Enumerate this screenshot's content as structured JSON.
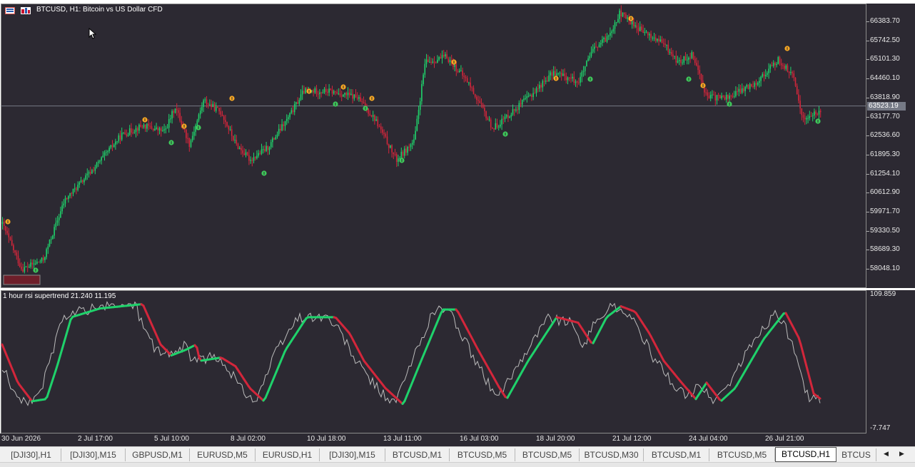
{
  "chart": {
    "title": "BTCUSD, H1:  Bitcoin vs US Dollar CFD",
    "current_price": "63523.19",
    "price_labels": [
      "66383.70",
      "65742.50",
      "65101.30",
      "64460.10",
      "63818.90",
      "63177.70",
      "62536.60",
      "61895.30",
      "61254.10",
      "60612.90",
      "59971.70",
      "59330.50",
      "58689.30",
      "58048.10"
    ],
    "time_labels": [
      "30 Jun 2026",
      "2 Jul 17:00",
      "5 Jul 10:00",
      "8 Jul 02:00",
      "10 Jul 18:00",
      "13 Jul 11:00",
      "16 Jul 03:00",
      "18 Jul 20:00",
      "21 Jul 12:00",
      "24 Jul 04:00",
      "26 Jul 21:00"
    ],
    "price_range": [
      57700,
      66800
    ],
    "price_line": 63523.19,
    "bull_color": "#1fd26b",
    "bear_color": "#d3263b",
    "sell_marker_color": "#f5a623",
    "buy_marker_color": "#3ec95a"
  },
  "indicator": {
    "title": "1 hour rsi supertrend  21.240 11.195",
    "scale_max": "109.859",
    "scale_min": "-7.747",
    "range": [
      -7.747,
      109.859
    ]
  },
  "tabs": [
    {
      "label": "[DJI30],H1"
    },
    {
      "label": "[DJI30],M15"
    },
    {
      "label": "GBPUSD,M1"
    },
    {
      "label": "EURUSD,M5"
    },
    {
      "label": "EURUSD,H1"
    },
    {
      "label": "[DJI30],M15"
    },
    {
      "label": "BTCUSD,M1"
    },
    {
      "label": "BTCUSD,M5"
    },
    {
      "label": "BTCUSD,M5"
    },
    {
      "label": "BTCUSD,M30"
    },
    {
      "label": "BTCUSD,M1"
    },
    {
      "label": "BTCUSD,M5"
    },
    {
      "label": "BTCUSD,H1"
    },
    {
      "label": "BTCUS"
    }
  ],
  "active_tab": 12,
  "icons": {
    "chart_icon": "flag-icon",
    "robot_icon": "expert-icon",
    "tab_prev": "arrow-left-icon",
    "tab_next": "arrow-right-icon"
  }
}
